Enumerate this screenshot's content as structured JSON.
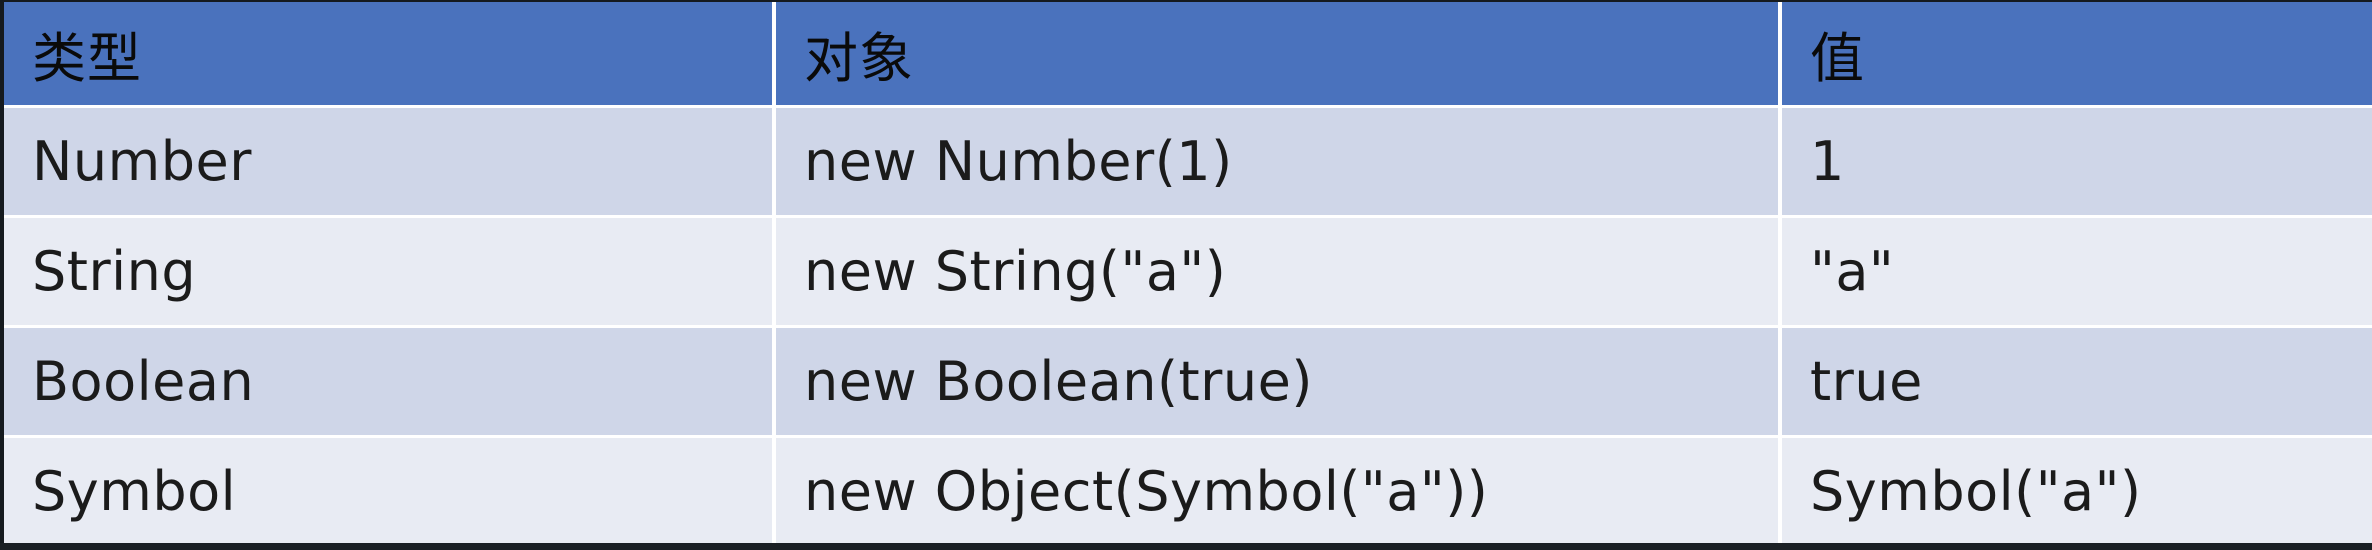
{
  "table": {
    "headers": [
      "类型",
      "对象",
      "值"
    ],
    "rows": [
      [
        "Number",
        "new Number(1)",
        "1"
      ],
      [
        "String",
        "new String(\"a\")",
        "\"a\""
      ],
      [
        "Boolean",
        "new Boolean(true)",
        "true"
      ],
      [
        "Symbol",
        "new Object(Symbol(\"a\"))",
        "Symbol(\"a\")"
      ]
    ]
  },
  "colors": {
    "header_bg": "#4a72bd",
    "row_odd_bg": "#cfd6e8",
    "row_even_bg": "#e8ebf3",
    "border": "#ffffff"
  }
}
